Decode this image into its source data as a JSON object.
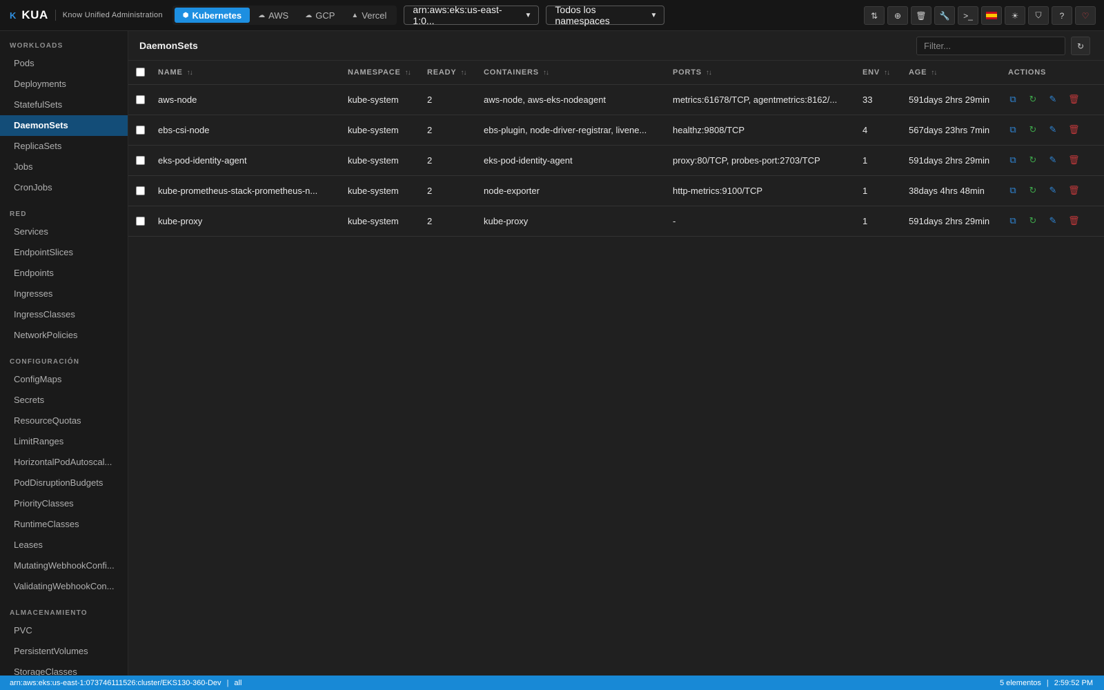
{
  "app": {
    "logo_letter": "K",
    "name": "KUA",
    "subtitle": "Know Unified Administration"
  },
  "providers": [
    {
      "label": "Kubernetes",
      "icon": "cube-icon",
      "active": true
    },
    {
      "label": "AWS",
      "icon": "cloud-icon",
      "active": false
    },
    {
      "label": "GCP",
      "icon": "cloud-icon",
      "active": false
    },
    {
      "label": "Vercel",
      "icon": "triangle-icon",
      "active": false
    }
  ],
  "cluster_select": {
    "value": "arn:aws:eks:us-east-1:0..."
  },
  "namespace_select": {
    "value": "Todos los namespaces"
  },
  "toolbar_icons": [
    "port-forward-icon",
    "plus-circle-icon",
    "trash-icon",
    "wrench-icon",
    "terminal-icon",
    "spain-flag-icon",
    "sun-icon",
    "shield-icon",
    "help-icon",
    "heart-icon"
  ],
  "sidebar": {
    "sections": [
      {
        "title": "WORKLOADS",
        "items": [
          "Pods",
          "Deployments",
          "StatefulSets",
          "DaemonSets",
          "ReplicaSets",
          "Jobs",
          "CronJobs"
        ]
      },
      {
        "title": "RED",
        "items": [
          "Services",
          "EndpointSlices",
          "Endpoints",
          "Ingresses",
          "IngressClasses",
          "NetworkPolicies"
        ]
      },
      {
        "title": "CONFIGURACIÓN",
        "items": [
          "ConfigMaps",
          "Secrets",
          "ResourceQuotas",
          "LimitRanges",
          "HorizontalPodAutoscal...",
          "PodDisruptionBudgets",
          "PriorityClasses",
          "RuntimeClasses",
          "Leases",
          "MutatingWebhookConfi...",
          "ValidatingWebhookCon..."
        ]
      },
      {
        "title": "ALMACENAMIENTO",
        "items": [
          "PVC",
          "PersistentVolumes",
          "StorageClasses"
        ]
      }
    ],
    "active_item": "DaemonSets"
  },
  "main": {
    "title": "DaemonSets",
    "filter_placeholder": "Filter...",
    "columns": [
      "NAME",
      "NAMESPACE",
      "READY",
      "CONTAINERS",
      "PORTS",
      "ENV",
      "AGE",
      "ACTIONS"
    ],
    "rows": [
      {
        "name": "aws-node",
        "namespace": "kube-system",
        "ready": "2",
        "containers": "aws-node, aws-eks-nodeagent",
        "ports": "metrics:61678/TCP, agentmetrics:8162/...",
        "env": "33",
        "age": "591days 2hrs 29min"
      },
      {
        "name": "ebs-csi-node",
        "namespace": "kube-system",
        "ready": "2",
        "containers": "ebs-plugin, node-driver-registrar, livene...",
        "ports": "healthz:9808/TCP",
        "env": "4",
        "age": "567days 23hrs 7min"
      },
      {
        "name": "eks-pod-identity-agent",
        "namespace": "kube-system",
        "ready": "2",
        "containers": "eks-pod-identity-agent",
        "ports": "proxy:80/TCP, probes-port:2703/TCP",
        "env": "1",
        "age": "591days 2hrs 29min"
      },
      {
        "name": "kube-prometheus-stack-prometheus-n...",
        "namespace": "kube-system",
        "ready": "2",
        "containers": "node-exporter",
        "ports": "http-metrics:9100/TCP",
        "env": "1",
        "age": "38days 4hrs 48min"
      },
      {
        "name": "kube-proxy",
        "namespace": "kube-system",
        "ready": "2",
        "containers": "kube-proxy",
        "ports": "-",
        "env": "1",
        "age": "591days 2hrs 29min"
      }
    ],
    "row_actions": [
      "copy-icon",
      "restart-icon",
      "edit-icon",
      "delete-icon"
    ]
  },
  "statusbar": {
    "cluster": "arn:aws:eks:us-east-1:073746111526:cluster/EKS130-360-Dev",
    "separator": "|",
    "namespace": "all",
    "count": "5 elementos",
    "time": "2:59:52 PM"
  },
  "colors": {
    "accent": "#1d8fe1",
    "sidebar_active": "#134d78",
    "action_blue": "#2f86d6",
    "action_green": "#3da34a",
    "action_red": "#c0393b"
  }
}
